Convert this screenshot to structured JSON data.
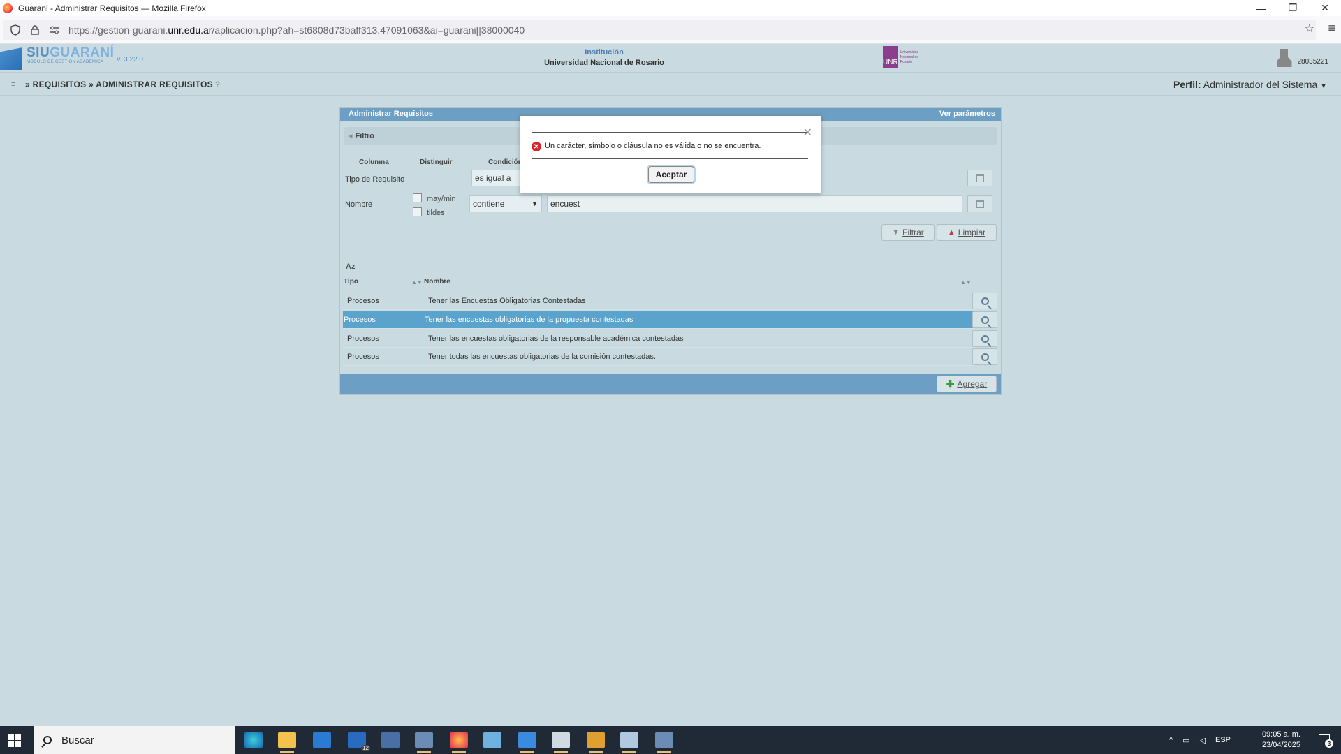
{
  "window": {
    "title": "Guarani - Administrar Requisitos — Mozilla Firefox",
    "controls": [
      "—",
      "❐",
      "✕"
    ]
  },
  "browser": {
    "url_prefix": "https://gestion-guarani.",
    "url_domain": "unr.edu.ar",
    "url_rest": "/aplicacion.php?ah=st6808d73baff313.47091063&ai=guarani||38000040"
  },
  "app": {
    "brand_siu": "SIU",
    "brand_guarani": "GUARANÍ",
    "brand_sub": "MÓDULO DE GESTIÓN ACADÉMICA",
    "version": "v. 3.22.0",
    "institution_label": "Institución",
    "institution_name": "Universidad Nacional de Rosario",
    "unr_logo_text": "UNR",
    "unr_logo_small": "Universidad Nacional de Rosario",
    "user_id": "28035221"
  },
  "breadcrumb": {
    "menu_icon": "≡",
    "items": "» REQUISITOS » ADMINISTRAR REQUISITOS",
    "help": "?",
    "perfil_label": "Perfil:",
    "perfil_value": "Administrador del Sistema",
    "perfil_caret": "▼"
  },
  "panel": {
    "title": "Administrar Requisitos",
    "params_link": "Ver parámetros",
    "filtro_label": "Filtro",
    "filtro_caret": "◂",
    "headers": {
      "columna": "Columna",
      "distinguir": "Distinguir",
      "condicion": "Condición"
    },
    "row1": {
      "label": "Tipo de Requisito",
      "condition": "es igual a"
    },
    "row2": {
      "label": "Nombre",
      "chk1": "may/min",
      "chk2": "tildes",
      "condition": "contiene",
      "value": "encuest"
    },
    "btn_filtrar": "Filtrar",
    "btn_limpiar": "Limpiar",
    "sort_icon": "Az",
    "col_tipo": "Tipo",
    "col_nombre": "Nombre",
    "sort_arrows": "▲▼",
    "rows": [
      {
        "tipo": "Procesos",
        "nombre": "Tener las Encuestas Obligatorias Contestadas"
      },
      {
        "tipo": "Procesos",
        "nombre": "Tener las encuestas obligatorias de la propuesta contestadas"
      },
      {
        "tipo": "Procesos",
        "nombre": "Tener las encuestas obligatorias de la responsable académica contestadas"
      },
      {
        "tipo": "Procesos",
        "nombre": "Tener todas las encuestas obligatorias de la comisión contestadas."
      }
    ],
    "btn_agregar": "Agregar"
  },
  "modal": {
    "message": "Un carácter, símbolo o cláusula no es válida o no se encuentra.",
    "ok_label": "Aceptar",
    "close_icon": "✕",
    "error_icon": "✕"
  },
  "taskbar": {
    "search_text": "Buscar",
    "tray_caret": "^",
    "lang": "ESP",
    "time": "09:05 a. m.",
    "date": "23/04/2025",
    "notif_count": "3",
    "mail_badge": "12"
  }
}
